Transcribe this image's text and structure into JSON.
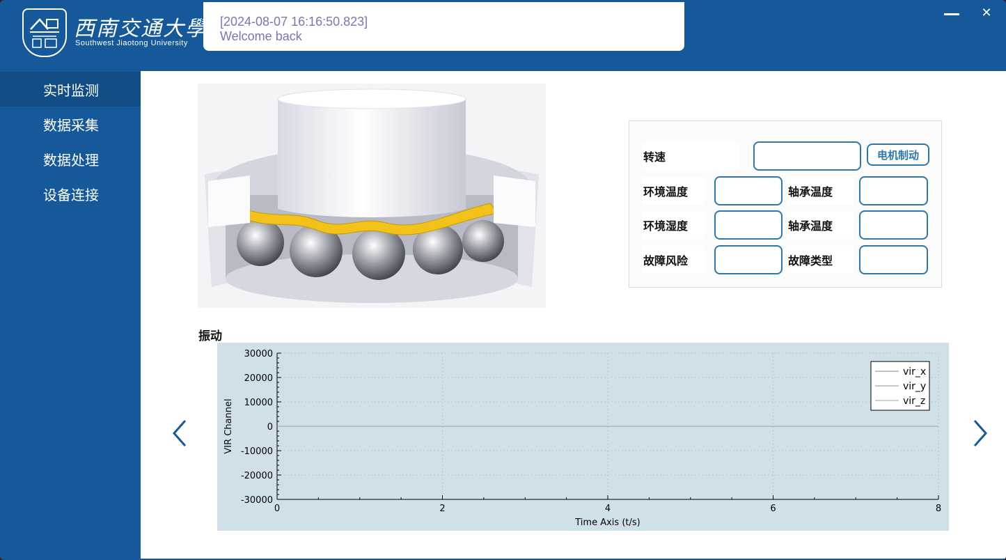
{
  "header": {
    "logo_cn": "西南交通大學",
    "logo_en": "Southwest Jiaotong University",
    "message_time": "[2024-08-07 16:16:50.823]",
    "message_text": "Welcome back",
    "minimize_icon": "minimize-icon",
    "close_icon": "close-icon",
    "close_glyph": "✕"
  },
  "sidebar": {
    "items": [
      {
        "label": "实时监测",
        "active": true
      },
      {
        "label": "数据采集",
        "active": false
      },
      {
        "label": "数据处理",
        "active": false
      },
      {
        "label": "设备连接",
        "active": false
      }
    ]
  },
  "params": {
    "speed_label": "转速",
    "speed_value": "",
    "brake_button": "电机制动",
    "env_temp_label": "环境温度",
    "env_temp_value": "",
    "bearing_temp_label": "轴承温度",
    "bearing_temp_value": "",
    "env_humidity_label": "环境湿度",
    "env_humidity_value": "",
    "bearing_temp2_label": "轴承温度",
    "bearing_temp2_value": "",
    "fault_risk_label": "故障风险",
    "fault_risk_value": "",
    "fault_type_label": "故障类型",
    "fault_type_value": ""
  },
  "vibration": {
    "title": "振动",
    "prev_icon": "chevron-left-icon",
    "next_icon": "chevron-right-icon"
  },
  "colors": {
    "primary": "#16599a",
    "sidebar_active": "#114d87",
    "input_border": "#2c77ad",
    "message_text": "#7f73b4",
    "chart_bg": "#d0e0e9"
  },
  "chart_data": {
    "type": "line",
    "title": "",
    "xlabel": "Time Axis (t/s)",
    "ylabel": "VIR Channel",
    "xlim": [
      0,
      8
    ],
    "ylim": [
      -30000,
      30000
    ],
    "xticks": [
      0,
      2,
      4,
      6,
      8
    ],
    "yticks": [
      -30000,
      -20000,
      -10000,
      0,
      10000,
      20000,
      30000
    ],
    "grid": true,
    "legend_position": "top-right",
    "series": [
      {
        "name": "vir_x",
        "x": [
          0,
          8
        ],
        "y": [
          0,
          0
        ]
      },
      {
        "name": "vir_y",
        "x": [
          0,
          8
        ],
        "y": [
          0,
          0
        ]
      },
      {
        "name": "vir_z",
        "x": [
          0,
          8
        ],
        "y": [
          0,
          0
        ]
      }
    ]
  }
}
